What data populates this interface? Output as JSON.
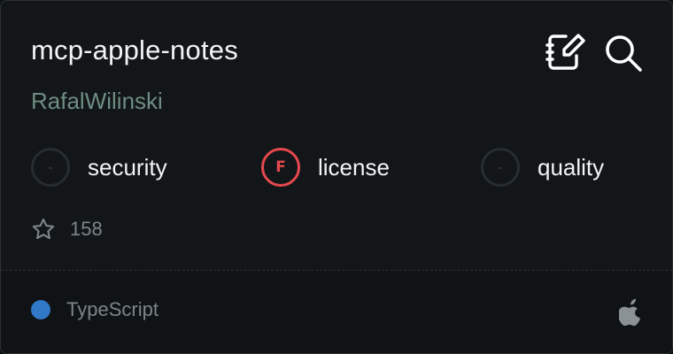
{
  "repo": {
    "name": "mcp-apple-notes",
    "author": "RafalWilinski"
  },
  "header_icons": {
    "notes": "notes-edit-icon",
    "search": "search-icon"
  },
  "metrics": [
    {
      "label": "security",
      "grade": "-",
      "status": "none"
    },
    {
      "label": "license",
      "grade": "F",
      "status": "fail"
    },
    {
      "label": "quality",
      "grade": "-",
      "status": "none"
    }
  ],
  "stars": {
    "icon": "star-icon",
    "count": "158"
  },
  "footer": {
    "language": "TypeScript",
    "language_color": "#3178c6",
    "platform_icon": "apple-icon"
  }
}
